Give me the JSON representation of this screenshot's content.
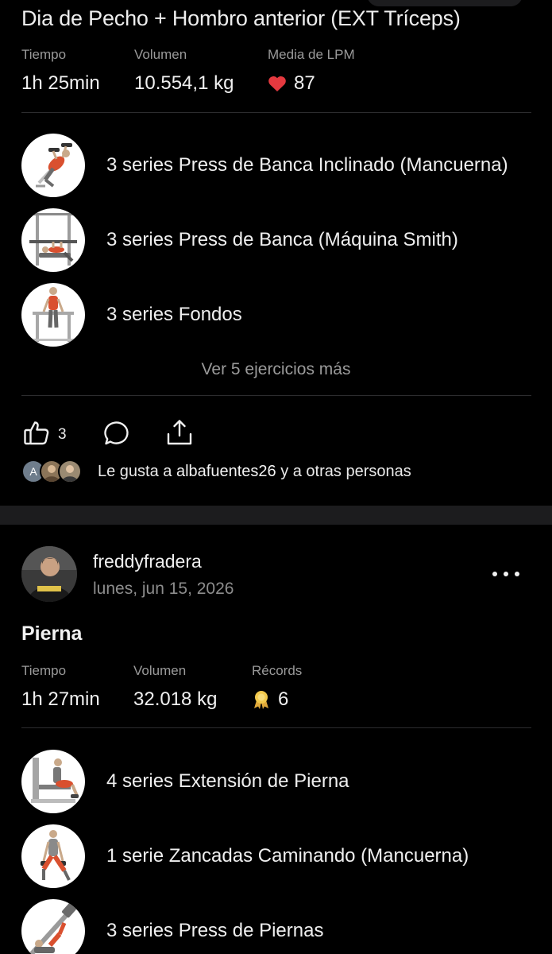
{
  "post1": {
    "title": "Dia de Pecho + Hombro anterior (EXT Tríceps)",
    "stats": [
      {
        "label": "Tiempo",
        "value": "1h 25min"
      },
      {
        "label": "Volumen",
        "value": "10.554,1 kg"
      },
      {
        "label": "Media de LPM",
        "value": "87",
        "icon": "heart-icon"
      }
    ],
    "exercises": [
      {
        "label": "3 series Press de Banca Inclinado (Mancuerna)",
        "icon": "incline-dumbbell-press-thumbnail"
      },
      {
        "label": "3 series Press de Banca (Máquina Smith)",
        "icon": "smith-bench-press-thumbnail"
      },
      {
        "label": "3 series Fondos",
        "icon": "dips-thumbnail"
      }
    ],
    "more_exercises": "Ver 5 ejercicios más",
    "actions": {
      "like_count": "3"
    },
    "likes": {
      "avatar_initial": "A",
      "prefix": "Le gusta a ",
      "user": "albafuentes26",
      "suffix": " y a otras personas"
    }
  },
  "post2": {
    "username": "freddyfradera",
    "date": "lunes, jun 15, 2026",
    "title": "Pierna",
    "stats": [
      {
        "label": "Tiempo",
        "value": "1h 27min"
      },
      {
        "label": "Volumen",
        "value": "32.018 kg"
      },
      {
        "label": "Récords",
        "value": "6",
        "icon": "medal-icon"
      }
    ],
    "exercises": [
      {
        "label": "4 series Extensión de Pierna",
        "icon": "leg-extension-thumbnail"
      },
      {
        "label": "1 serie Zancadas Caminando (Mancuerna)",
        "icon": "walking-lunges-thumbnail"
      },
      {
        "label": "3 series Press de Piernas",
        "icon": "leg-press-thumbnail"
      }
    ]
  },
  "colors": {
    "background": "#000000",
    "divider": "#2c2c2e",
    "muted_text": "#9a9a9a",
    "heart": "#e5393f",
    "medal": "#f2c94c",
    "muscle_highlight": "#d9502f"
  }
}
